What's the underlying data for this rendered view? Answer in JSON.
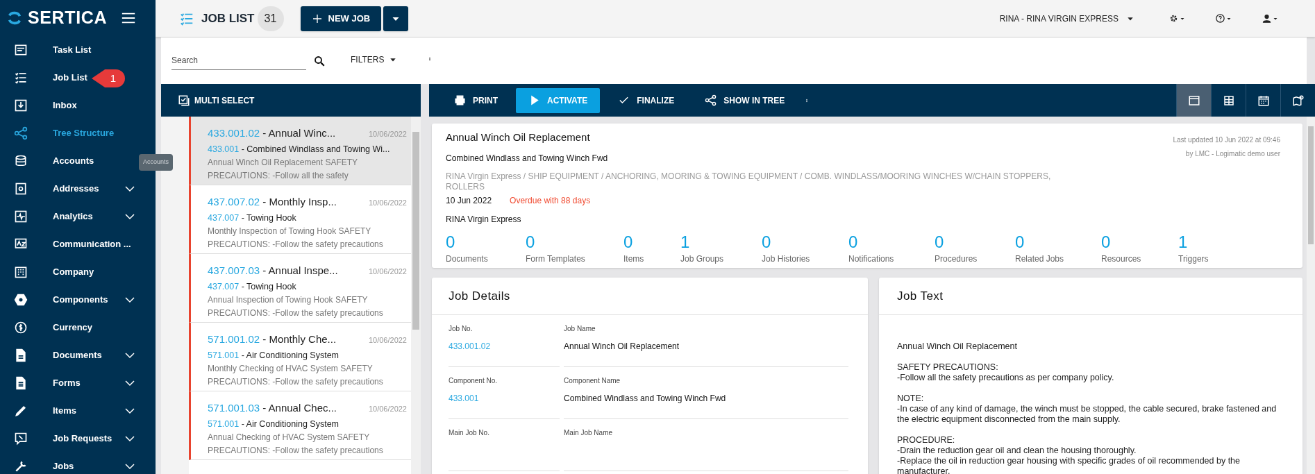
{
  "sidebar": {
    "logo": "SERTICA",
    "items": [
      {
        "label": "Task List",
        "kind": "link",
        "selected": false
      },
      {
        "label": "Job List",
        "kind": "link",
        "selected": false
      },
      {
        "label": "Inbox",
        "kind": "link",
        "selected": false
      },
      {
        "label": "Tree Structure",
        "kind": "link",
        "selected": true
      },
      {
        "label": "Accounts",
        "kind": "link",
        "selected": false
      },
      {
        "label": "Addresses",
        "kind": "group",
        "selected": false
      },
      {
        "label": "Analytics",
        "kind": "group",
        "selected": false
      },
      {
        "label": "Communication ...",
        "kind": "link",
        "selected": false
      },
      {
        "label": "Company",
        "kind": "link",
        "selected": false
      },
      {
        "label": "Components",
        "kind": "group",
        "selected": false
      },
      {
        "label": "Currency",
        "kind": "link",
        "selected": false
      },
      {
        "label": "Documents",
        "kind": "group",
        "selected": false
      },
      {
        "label": "Forms",
        "kind": "group",
        "selected": false
      },
      {
        "label": "Items",
        "kind": "group",
        "selected": false
      },
      {
        "label": "Job Requests",
        "kind": "group",
        "selected": false
      },
      {
        "label": "Jobs",
        "kind": "group",
        "selected": false
      }
    ],
    "callout": "1",
    "tooltip": "Accounts"
  },
  "topbar": {
    "title": "JOB LIST",
    "count": "31",
    "new_job": "NEW JOB",
    "vessel": "RINA - RINA VIRGIN EXPRESS"
  },
  "job_list": {
    "search": {
      "placeholder": "Search"
    },
    "filters": "FILTERS",
    "multi_select": "MULTI SELECT",
    "jobs": [
      {
        "number": "433.001.02",
        "title": " - Annual Winc...",
        "date": "10/06/2022",
        "component_no": "433.001",
        "component": " - Combined Windlass and Towing Wi...",
        "description": "Annual Winch Oil Replacement SAFETY PRECAUTIONS: -Follow all the safety",
        "selected": true
      },
      {
        "number": "437.007.02",
        "title": " - Monthly Insp...",
        "date": "10/06/2022",
        "component_no": "437.007",
        "component": " - Towing Hook",
        "description": "Monthly Inspection of Towing Hook SAFETY PRECAUTIONS: -Follow the safety precautions",
        "selected": false
      },
      {
        "number": "437.007.03",
        "title": " - Annual Inspe...",
        "date": "10/06/2022",
        "component_no": "437.007",
        "component": " - Towing Hook",
        "description": "Annual Inspection of Towing Hook SAFETY PRECAUTIONS: -Follow the safety precautions",
        "selected": false
      },
      {
        "number": "571.001.02",
        "title": " - Monthly Che...",
        "date": "10/06/2022",
        "component_no": "571.001",
        "component": " - Air Conditioning System",
        "description": "Monthly Checking of HVAC System SAFETY PRECAUTIONS: -Follow the safety precautions",
        "selected": false
      },
      {
        "number": "571.001.03",
        "title": " - Annual Chec...",
        "date": "10/06/2022",
        "component_no": "571.001",
        "component": " - Air Conditioning System",
        "description": "Annual Checking of HVAC System SAFETY PRECAUTIONS: -Follow the safety precautions",
        "selected": false
      }
    ]
  },
  "toolbar": {
    "actions": [
      {
        "label": "PRINT",
        "kind": "print"
      },
      {
        "label": "ACTIVATE",
        "kind": "activate"
      },
      {
        "label": "FINALIZE",
        "kind": "finalize"
      },
      {
        "label": "SHOW IN TREE",
        "kind": "tree"
      }
    ],
    "views": [
      {
        "kind": "panel",
        "selected": true
      },
      {
        "kind": "grid",
        "selected": false
      },
      {
        "kind": "calendar",
        "selected": false
      },
      {
        "kind": "map",
        "selected": false
      }
    ]
  },
  "summary": {
    "title": "Annual Winch Oil Replacement",
    "component": "Combined Windlass and Towing Winch Fwd",
    "path": "RINA Virgin Express / SHIP EQUIPMENT / ANCHORING, MOORING & TOWING EQUIPMENT / COMB. WINDLASS/MOORING WINCHES W/CHAIN STOPPERS, ROLLERS",
    "date": "10 Jun 2022",
    "overdue": "Overdue with 88 days",
    "vessel": "RINA Virgin Express",
    "updated": "Last updated 10 Jun 2022 at 09:46",
    "updated_by": "by LMC - Logimatic demo user",
    "counts": [
      {
        "value": "0",
        "label": "Documents"
      },
      {
        "value": "0",
        "label": "Form Templates"
      },
      {
        "value": "0",
        "label": "Items"
      },
      {
        "value": "1",
        "label": "Job Groups"
      },
      {
        "value": "0",
        "label": "Job Histories"
      },
      {
        "value": "0",
        "label": "Notifications"
      },
      {
        "value": "0",
        "label": "Procedures"
      },
      {
        "value": "0",
        "label": "Related Jobs"
      },
      {
        "value": "0",
        "label": "Resources"
      },
      {
        "value": "1",
        "label": "Triggers"
      }
    ]
  },
  "job_details": {
    "title": "Job Details",
    "fields": [
      {
        "label": "Job No.",
        "value": "433.001.02",
        "kind": "link"
      },
      {
        "label": "Job Name",
        "value": "Annual Winch Oil Replacement",
        "kind": "plain"
      },
      {
        "label": "Component No.",
        "value": "433.001",
        "kind": "link"
      },
      {
        "label": "Component Name",
        "value": "Combined Windlass and Towing Winch Fwd",
        "kind": "plain"
      },
      {
        "label": "Main Job No."
      },
      {
        "label": "Main Job Name"
      }
    ]
  },
  "job_text": {
    "title": "Job Text",
    "paragraphs": [
      [
        "Annual Winch Oil Replacement"
      ],
      [
        "SAFETY PRECAUTIONS:",
        "-Follow all the safety precautions as per company policy."
      ],
      [
        "NOTE:",
        "-In case of any kind of damage, the winch must be stopped, the cable secured, brake fastened and the electric equipment disconnected from the main supply."
      ],
      [
        "PROCEDURE:",
        "-Drain the reduction gear oil and clean the housing thoroughly.",
        "-Replace the oil in reduction gear housing with specific grades of oil recommended by the manufacturer."
      ]
    ]
  }
}
